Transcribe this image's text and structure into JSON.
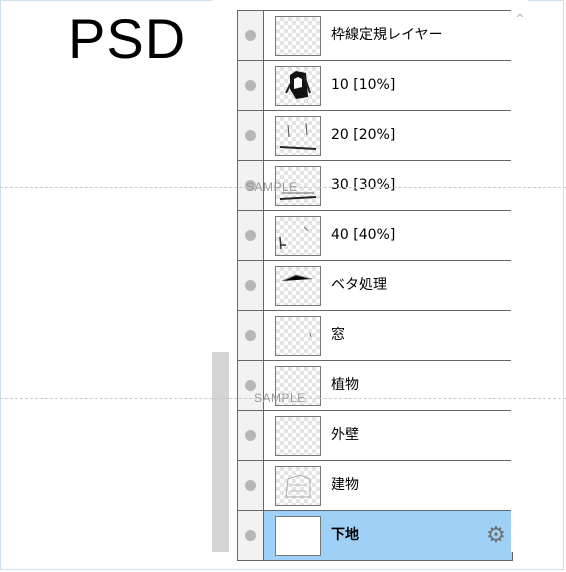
{
  "header": {
    "title": "PSD"
  },
  "watermark": {
    "text": "SAMPLE"
  },
  "scroll": {
    "up_icon": "chevron-up-icon"
  },
  "layers": [
    {
      "name": "枠線定規レイヤー",
      "selected": false
    },
    {
      "name": "10 [10%]",
      "selected": false
    },
    {
      "name": "20 [20%]",
      "selected": false
    },
    {
      "name": "30 [30%]",
      "selected": false
    },
    {
      "name": "40 [40%]",
      "selected": false
    },
    {
      "name": "ベタ処理",
      "selected": false
    },
    {
      "name": "窓",
      "selected": false
    },
    {
      "name": "植物",
      "selected": false
    },
    {
      "name": "外壁",
      "selected": false
    },
    {
      "name": "建物",
      "selected": false
    },
    {
      "name": "下地",
      "selected": true
    }
  ],
  "colors": {
    "selected_row": "#9fd0f6",
    "visibility_dot": "#b7b7b7"
  }
}
